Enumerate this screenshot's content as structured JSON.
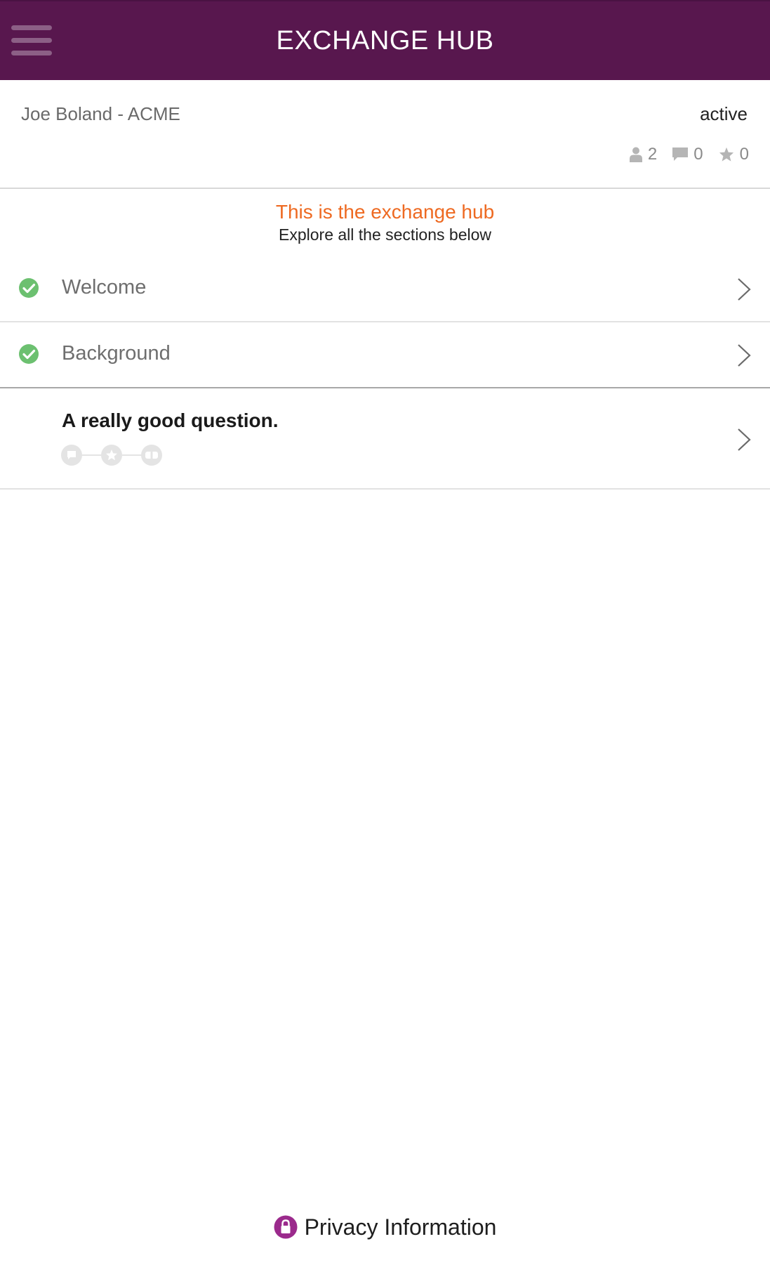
{
  "header": {
    "title": "EXCHANGE HUB",
    "menu_icon": "hamburger-menu-icon",
    "background_color": "#58174e"
  },
  "user_panel": {
    "name": "Joe Boland - ACME",
    "status": "active",
    "stats": {
      "participants": "2",
      "comments": "0",
      "stars": "0"
    },
    "stat_icons": [
      "person-icon",
      "comment-icon",
      "star-icon"
    ]
  },
  "intro": {
    "title": "This is the exchange hub",
    "subtitle": "Explore all the sections below",
    "title_color": "#ee6a22"
  },
  "sections": [
    {
      "label": "Welcome",
      "completed": true,
      "icon": "check-circle-icon"
    },
    {
      "label": "Background",
      "completed": true,
      "icon": "check-circle-icon"
    },
    {
      "label": "A really good question.",
      "completed": false,
      "progress_icons": [
        "comment-icon",
        "star-icon",
        "ticket-icon"
      ]
    }
  ],
  "footer": {
    "label": "Privacy Information",
    "icon": "lock-icon",
    "icon_color": "#9b2a8c"
  },
  "colors": {
    "check_green": "#6cc070",
    "progress_gray": "#e4e4e4"
  }
}
